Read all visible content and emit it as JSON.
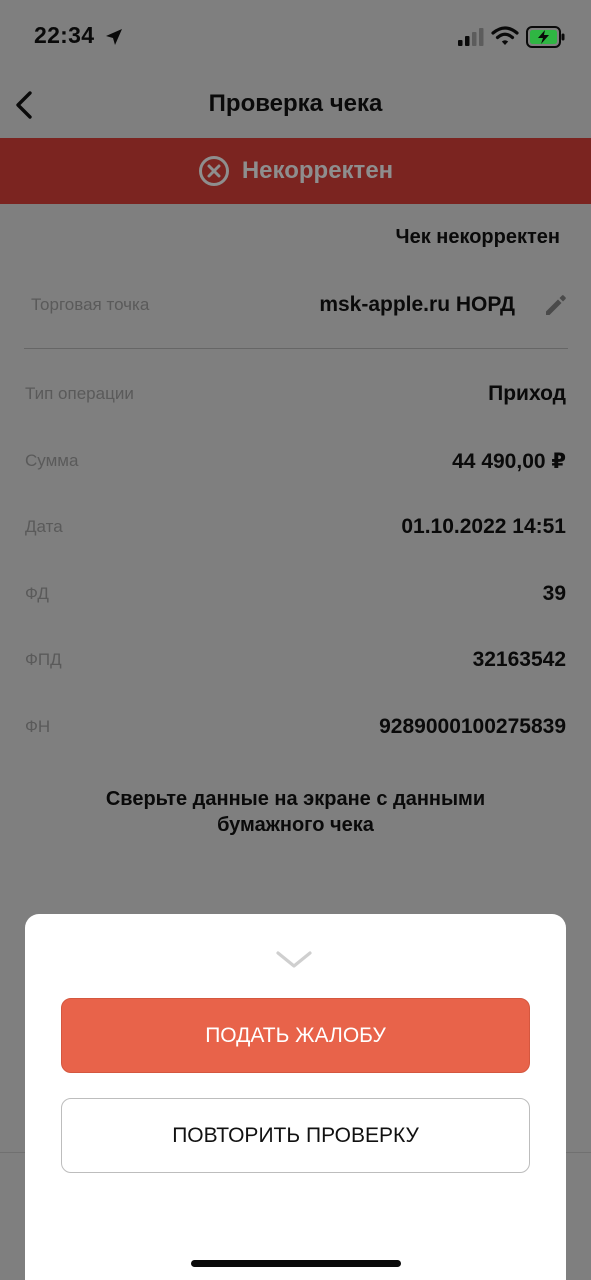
{
  "status_bar": {
    "time": "22:34"
  },
  "nav": {
    "title": "Проверка чека"
  },
  "banner": {
    "text": "Некорректен",
    "color": "#7b2420"
  },
  "receipt_status": "Чек некорректен",
  "store": {
    "label": "Торговая точка",
    "value": "msk-apple.ru НОРД"
  },
  "rows": [
    {
      "label": "Тип операции",
      "value": "Приход"
    },
    {
      "label": "Сумма",
      "value": "44 490,00 ₽"
    },
    {
      "label": "Дата",
      "value": "01.10.2022 14:51"
    },
    {
      "label": "ФД",
      "value": "39"
    },
    {
      "label": "ФПД",
      "value": "32163542"
    },
    {
      "label": "ФН",
      "value": "9289000100275839"
    }
  ],
  "hint": {
    "line1": "Сверьте данные на экране с данными",
    "line2": "бумажного чека"
  },
  "sheet": {
    "complaint_label": "ПОДАТЬ ЖАЛОБУ",
    "retry_label": "ПОВТОРИТЬ ПРОВЕРКУ",
    "accent_color": "#e8634a"
  },
  "icons": {
    "location": "location-arrow-icon",
    "signal": "cellular-signal-icon",
    "wifi": "wifi-icon",
    "battery": "battery-charging-icon",
    "back": "chevron-left-icon",
    "error": "close-circle-icon",
    "edit": "pencil-icon",
    "collapse": "chevron-down-icon"
  }
}
